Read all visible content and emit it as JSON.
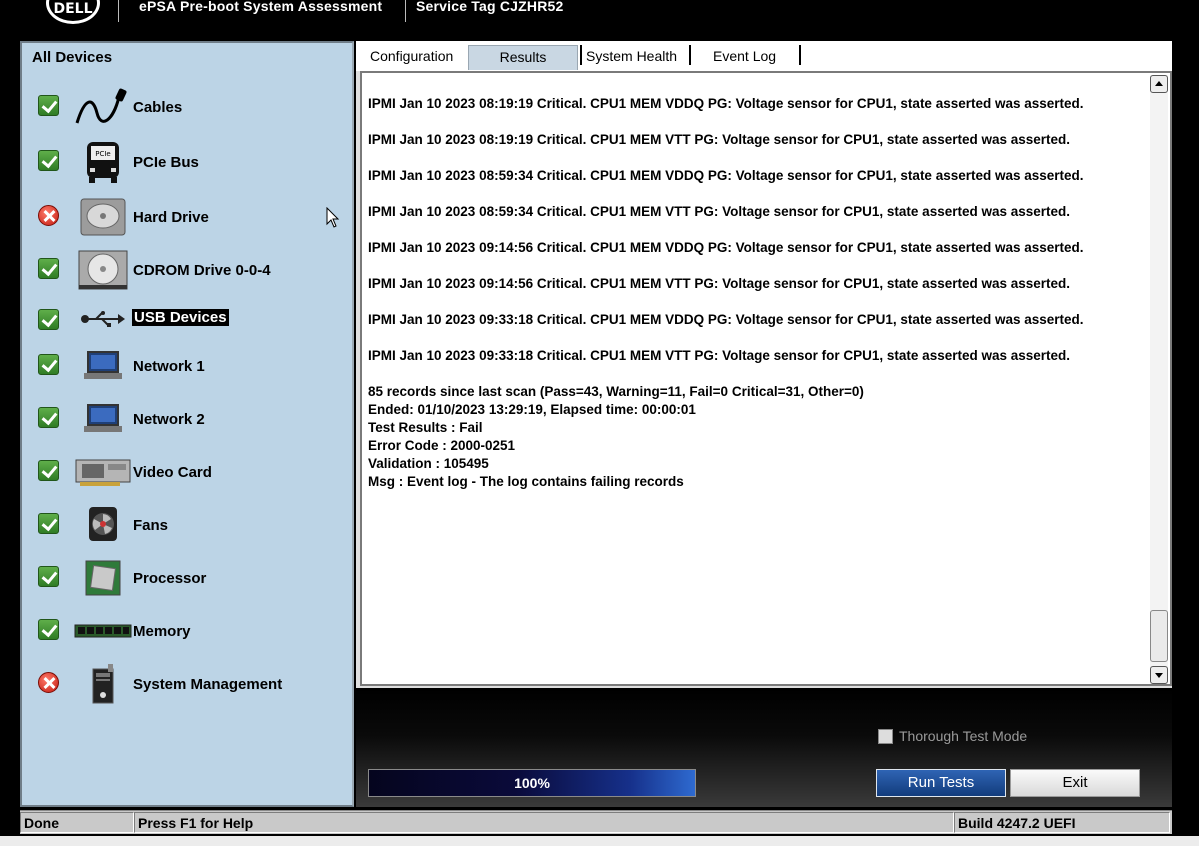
{
  "titlebar": {
    "logo_text": "DELL",
    "app_title": "ePSA Pre-boot System Assessment",
    "service_tag": "Service Tag CJZHR52"
  },
  "left_panel": {
    "header": "All Devices",
    "devices": [
      {
        "label": "Cables",
        "status": "pass",
        "icon": "cable-icon"
      },
      {
        "label": "PCIe Bus",
        "status": "pass",
        "icon": "pcie-bus-icon"
      },
      {
        "label": "Hard Drive",
        "status": "fail",
        "icon": "hard-drive-icon"
      },
      {
        "label": "CDROM Drive 0-0-4",
        "status": "pass",
        "icon": "cdrom-icon"
      },
      {
        "label": "USB Devices",
        "status": "pass",
        "icon": "usb-icon",
        "selected": true
      },
      {
        "label": "Network 1",
        "status": "pass",
        "icon": "laptop-network-icon"
      },
      {
        "label": "Network 2",
        "status": "pass",
        "icon": "laptop-network-icon"
      },
      {
        "label": "Video Card",
        "status": "pass",
        "icon": "video-card-icon"
      },
      {
        "label": "Fans",
        "status": "pass",
        "icon": "fan-icon"
      },
      {
        "label": "Processor",
        "status": "pass",
        "icon": "processor-icon"
      },
      {
        "label": "Memory",
        "status": "pass",
        "icon": "memory-icon"
      },
      {
        "label": "System Management",
        "status": "fail",
        "icon": "system-management-icon"
      }
    ]
  },
  "tabs": [
    {
      "label": "Configuration",
      "active": false
    },
    {
      "label": "Results",
      "active": true
    },
    {
      "label": "System Health",
      "active": false
    },
    {
      "label": "Event Log",
      "active": false
    }
  ],
  "log": {
    "entries": [
      "IPMI Jan 10 2023 08:19:19 Critical. CPU1 MEM VDDQ PG: Voltage sensor for CPU1, state asserted was asserted.",
      "IPMI Jan 10 2023 08:19:19 Critical. CPU1 MEM VTT PG: Voltage sensor for CPU1, state asserted was asserted.",
      "IPMI Jan 10 2023 08:59:34 Critical. CPU1 MEM VDDQ PG: Voltage sensor for CPU1, state asserted was asserted.",
      "IPMI Jan 10 2023 08:59:34 Critical. CPU1 MEM VTT PG: Voltage sensor for CPU1, state asserted was asserted.",
      "IPMI Jan 10 2023 09:14:56 Critical. CPU1 MEM VDDQ PG: Voltage sensor for CPU1, state asserted was asserted.",
      "IPMI Jan 10 2023 09:14:56 Critical. CPU1 MEM VTT PG: Voltage sensor for CPU1, state asserted was asserted.",
      "IPMI Jan 10 2023 09:33:18 Critical. CPU1 MEM VDDQ PG: Voltage sensor for CPU1, state asserted was asserted.",
      "IPMI Jan 10 2023 09:33:18 Critical. CPU1 MEM VTT PG: Voltage sensor for CPU1, state asserted was asserted."
    ],
    "summary": [
      "85 records since last scan (Pass=43, Warning=11, Fail=0 Critical=31, Other=0)",
      "Ended: 01/10/2023 13:29:19, Elapsed time: 00:00:01",
      "Test Results : Fail",
      "Error Code : 2000-0251",
      "Validation : 105495",
      "Msg : Event log - The log contains failing records"
    ]
  },
  "controls": {
    "thorough_mode_label": "Thorough Test Mode",
    "thorough_mode_checked": false,
    "progress_text": "100%",
    "progress_value": 1.0,
    "run_tests_label": "Run Tests",
    "exit_label": "Exit"
  },
  "statusbar": {
    "status": "Done",
    "help": "Press F1 for Help",
    "build": "Build  4247.2 UEFI"
  }
}
